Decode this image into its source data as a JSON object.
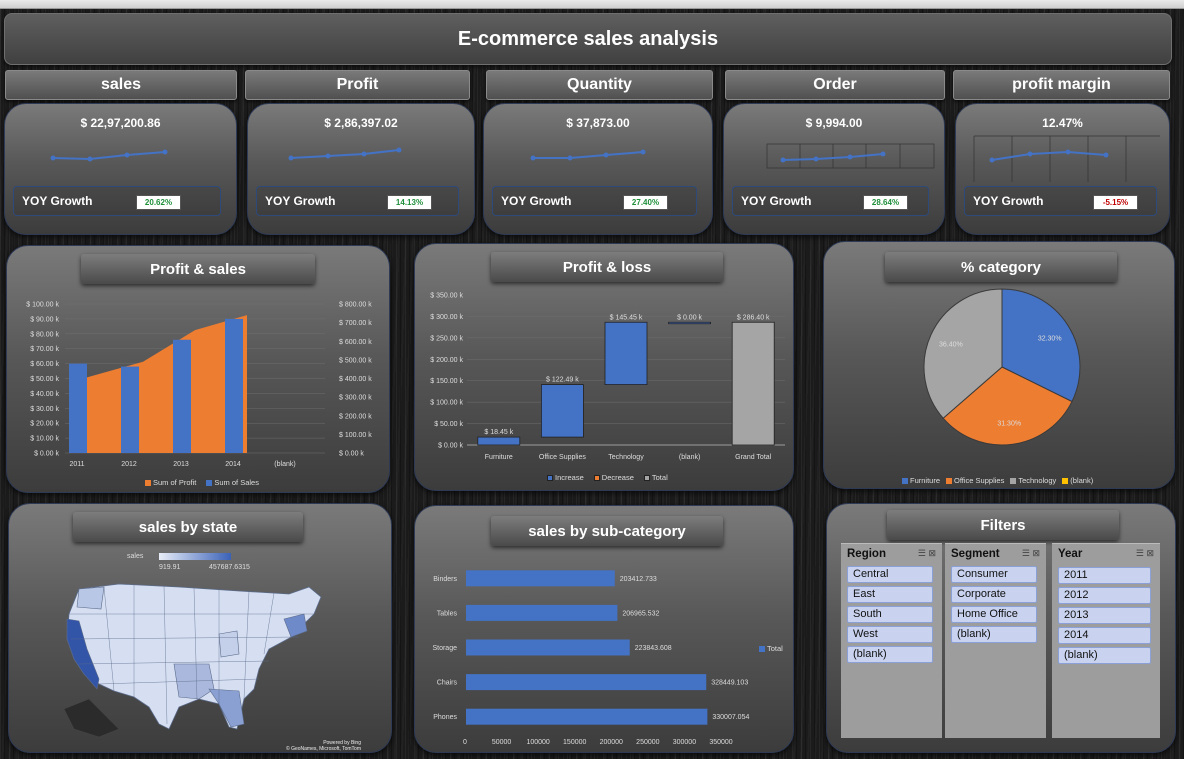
{
  "title": "E-commerce sales analysis",
  "kpis": [
    {
      "label": "sales",
      "value": "$ 22,97,200.86",
      "yoy_label": "YOY Growth",
      "yoy": "20.62%",
      "yoy_positive": true
    },
    {
      "label": "Profit",
      "value": "$ 2,86,397.02",
      "yoy_label": "YOY Growth",
      "yoy": "14.13%",
      "yoy_positive": true
    },
    {
      "label": "Quantity",
      "value": "$ 37,873.00",
      "yoy_label": "YOY Growth",
      "yoy": "27.40%",
      "yoy_positive": true
    },
    {
      "label": "Order",
      "value": "$ 9,994.00",
      "yoy_label": "YOY Growth",
      "yoy": "28.64%",
      "yoy_positive": true
    },
    {
      "label": "profit margin",
      "value": "12.47%",
      "yoy_label": "YOY Growth",
      "yoy": "-5.15%",
      "yoy_positive": false
    }
  ],
  "profit_sales": {
    "title": "Profit & sales",
    "chart_data": {
      "type": "bar",
      "categories": [
        "2011",
        "2012",
        "2013",
        "2014",
        "(blank)"
      ],
      "series": [
        {
          "name": "Sum of Sales",
          "values": [
            60,
            58,
            76,
            90,
            null
          ],
          "color": "#4472c4"
        },
        {
          "name": "Sum of Profit",
          "values": [
            400,
            490,
            660,
            740,
            null
          ],
          "color": "#ed7d31"
        }
      ],
      "left_ticks": [
        "$ 0.00 k",
        "$ 10.00 k",
        "$ 20.00 k",
        "$ 30.00 k",
        "$ 40.00 k",
        "$ 50.00 k",
        "$ 60.00 k",
        "$ 70.00 k",
        "$ 80.00 k",
        "$ 90.00 k",
        "$ 100.00 k"
      ],
      "right_ticks": [
        "$ 0.00 k",
        "$ 100.00 k",
        "$ 200.00 k",
        "$ 300.00 k",
        "$ 400.00 k",
        "$ 500.00 k",
        "$ 600.00 k",
        "$ 700.00 k",
        "$ 800.00 k"
      ],
      "legend": [
        "Sum of Profit",
        "Sum of Sales"
      ]
    }
  },
  "profit_loss": {
    "title": "Profit & loss",
    "chart_data": {
      "type": "bar",
      "categories": [
        "Furniture",
        "Office Supplies",
        "Technology",
        "(blank)",
        "Grand Total"
      ],
      "labels": [
        "$ 18.45 k",
        "$ 122.49 k",
        "$ 145.45 k",
        "$ 0.00 k",
        "$ 286.40 k"
      ],
      "increments": [
        18.45,
        122.49,
        145.45,
        0,
        286.4
      ],
      "y_ticks": [
        "$ 0.00 k",
        "$ 50.00 k",
        "$ 100.00 k",
        "$ 150.00 k",
        "$ 200.00 k",
        "$ 250.00 k",
        "$ 300.00 k",
        "$ 350.00 k"
      ],
      "ylim": [
        0,
        350
      ],
      "legend": [
        "Increase",
        "Decrease",
        "Total"
      ]
    }
  },
  "category": {
    "title": "% category",
    "chart_data": {
      "type": "pie",
      "labels": [
        "Furniture",
        "Office Supplies",
        "Technology",
        "(blank)"
      ],
      "values": [
        32.3,
        31.3,
        36.4,
        0.0
      ],
      "value_labels": [
        "32.30%",
        "31.30%",
        "36.40%",
        "0.00%"
      ],
      "colors": [
        "#4472c4",
        "#ed7d31",
        "#a5a5a5",
        "#ffc000"
      ]
    }
  },
  "state": {
    "title": "sales by state",
    "legend_label": "sales",
    "min": "919.91",
    "max": "457687.6315",
    "attribution_1": "Powered by Bing",
    "attribution_2": "© GeoNames, Microsoft, TomTom"
  },
  "subcat": {
    "title": "sales by sub-category",
    "chart_data": {
      "type": "bar",
      "categories": [
        "Binders",
        "Tables",
        "Storage",
        "Chairs",
        "Phones"
      ],
      "values": [
        203412.733,
        206965.532,
        223843.608,
        328449.103,
        330007.054
      ],
      "value_labels": [
        "203412.733",
        "206965.532",
        "223843.608",
        "328449.103",
        "330007.054"
      ],
      "x_ticks": [
        "0",
        "50000",
        "100000",
        "150000",
        "200000",
        "250000",
        "300000",
        "350000"
      ],
      "xlim": [
        0,
        350000
      ],
      "legend": "Total"
    }
  },
  "filters": {
    "title": "Filters",
    "slicers": [
      {
        "name": "Region",
        "items": [
          "Central",
          "East",
          "South",
          "West",
          "(blank)"
        ]
      },
      {
        "name": "Segment",
        "items": [
          "Consumer",
          "Corporate",
          "Home Office",
          "(blank)"
        ]
      },
      {
        "name": "Year",
        "items": [
          "2011",
          "2012",
          "2013",
          "2014",
          "(blank)"
        ]
      }
    ]
  }
}
